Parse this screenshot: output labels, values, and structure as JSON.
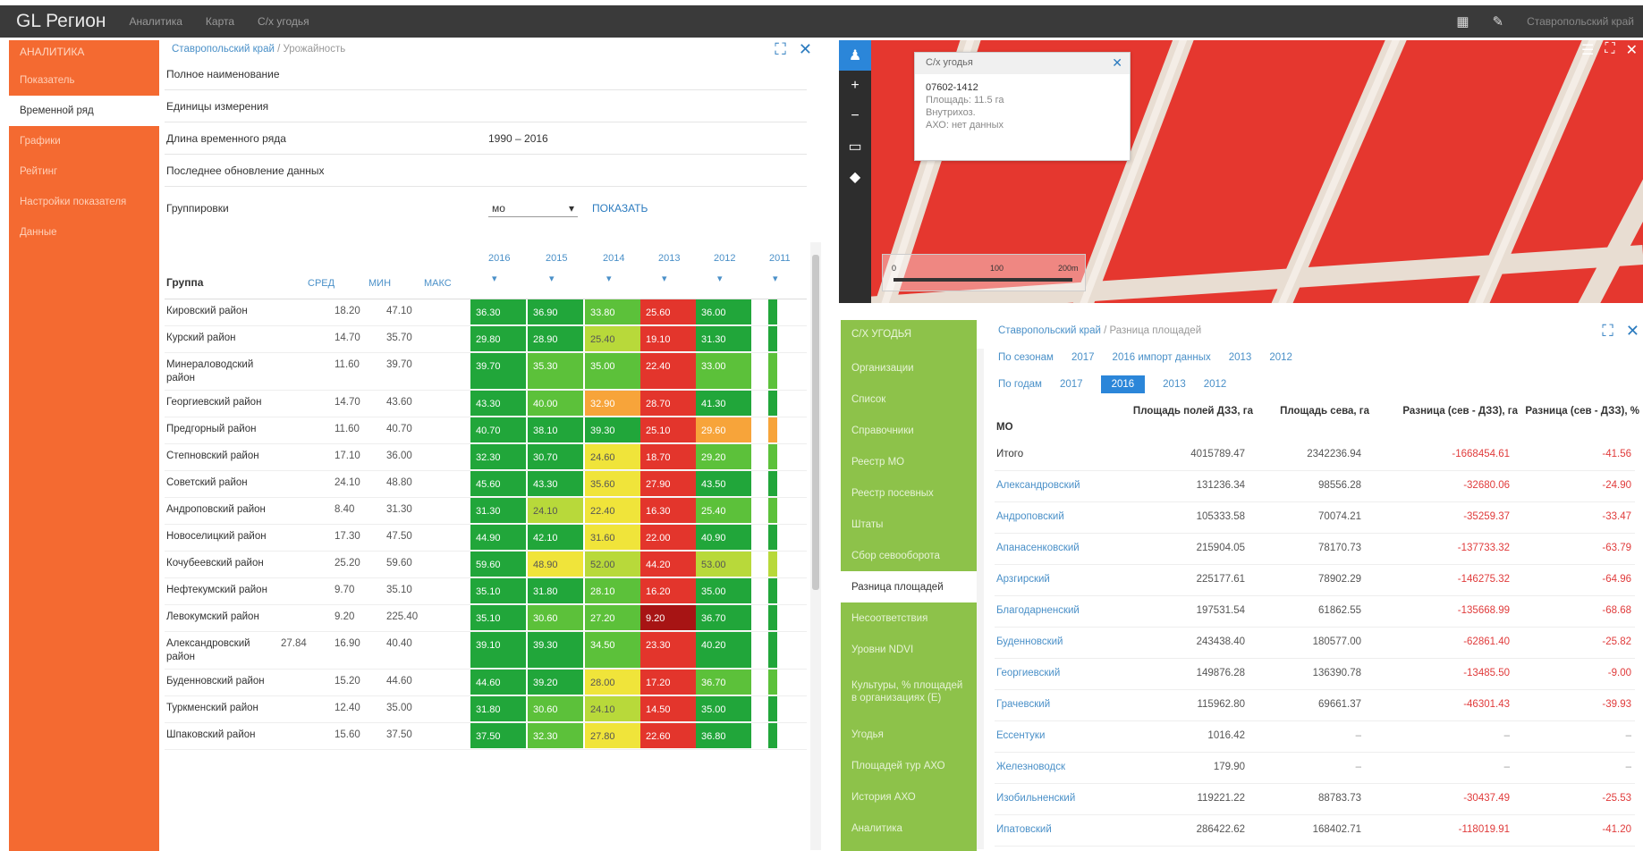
{
  "header": {
    "brand": "GL Регион",
    "nav": [
      "Аналитика",
      "Карта",
      "С/х угодья"
    ],
    "region": "Ставропольский край"
  },
  "left_sidebar": {
    "title": "АНАЛИТИКА",
    "items": [
      "Показатель",
      "Временной ряд",
      "Графики",
      "Рейтинг",
      "Настройки показателя",
      "Данные"
    ]
  },
  "ts_panel": {
    "breadcrumb": [
      "Ставропольский край",
      "Урожайность"
    ],
    "info": [
      {
        "label": "Полное наименование",
        "value": ""
      },
      {
        "label": "Единицы измерения",
        "value": ""
      },
      {
        "label": "Длина временного ряда",
        "value": "1990 – 2016"
      },
      {
        "label": "Последнее обновление данных",
        "value": ""
      }
    ],
    "group_label": "Группировки",
    "group_value": "мо",
    "show_btn": "ПОКАЗАТЬ",
    "columns": {
      "group": "Группа",
      "avg": "СРЕД",
      "min": "МИН",
      "max": "МАКС",
      "years": [
        "2016",
        "2015",
        "2014",
        "2013",
        "2012",
        "2011"
      ]
    },
    "rows": [
      {
        "name": "Кировский район",
        "avg": "",
        "min": "18.20",
        "max": "47.10",
        "vals": [
          "36.30",
          "36.90",
          "33.80",
          "25.60",
          "36.00"
        ]
      },
      {
        "name": "Курский район",
        "avg": "",
        "min": "14.70",
        "max": "35.70",
        "vals": [
          "29.80",
          "28.90",
          "25.40",
          "19.10",
          "31.30"
        ]
      },
      {
        "name": "Минераловодский район",
        "avg": "",
        "min": "11.60",
        "max": "39.70",
        "vals": [
          "39.70",
          "35.30",
          "35.00",
          "22.40",
          "33.00"
        ]
      },
      {
        "name": "Георгиевский район",
        "avg": "",
        "min": "14.70",
        "max": "43.60",
        "vals": [
          "43.30",
          "40.00",
          "32.90",
          "28.70",
          "41.30"
        ]
      },
      {
        "name": "Предгорный район",
        "avg": "",
        "min": "11.60",
        "max": "40.70",
        "vals": [
          "40.70",
          "38.10",
          "39.30",
          "25.10",
          "29.60"
        ]
      },
      {
        "name": "Степновский район",
        "avg": "",
        "min": "17.10",
        "max": "36.00",
        "vals": [
          "32.30",
          "30.70",
          "24.60",
          "18.70",
          "29.20"
        ]
      },
      {
        "name": "Советский район",
        "avg": "",
        "min": "24.10",
        "max": "48.80",
        "vals": [
          "45.60",
          "43.30",
          "35.60",
          "27.90",
          "43.50"
        ]
      },
      {
        "name": "Андроповский район",
        "avg": "",
        "min": "8.40",
        "max": "31.30",
        "vals": [
          "31.30",
          "24.10",
          "22.40",
          "16.30",
          "25.40"
        ]
      },
      {
        "name": "Новоселицкий район",
        "avg": "",
        "min": "17.30",
        "max": "47.50",
        "vals": [
          "44.90",
          "42.10",
          "31.60",
          "22.00",
          "40.90"
        ]
      },
      {
        "name": "Кочубеевский район",
        "avg": "",
        "min": "25.20",
        "max": "59.60",
        "vals": [
          "59.60",
          "48.90",
          "52.00",
          "44.20",
          "53.00"
        ]
      },
      {
        "name": "Нефтекумский район",
        "avg": "",
        "min": "9.70",
        "max": "35.10",
        "vals": [
          "35.10",
          "31.80",
          "28.10",
          "16.20",
          "35.00"
        ]
      },
      {
        "name": "Левокумский район",
        "avg": "",
        "min": "9.20",
        "max": "225.40",
        "vals": [
          "35.10",
          "30.60",
          "27.20",
          "9.20",
          "36.70"
        ]
      },
      {
        "name": "Александровский район",
        "avg": "27.84",
        "min": "16.90",
        "max": "40.40",
        "vals": [
          "39.10",
          "39.30",
          "34.50",
          "23.30",
          "40.20"
        ]
      },
      {
        "name": "Буденновский район",
        "avg": "",
        "min": "15.20",
        "max": "44.60",
        "vals": [
          "44.60",
          "39.20",
          "28.00",
          "17.20",
          "36.70"
        ]
      },
      {
        "name": "Туркменский район",
        "avg": "",
        "min": "12.40",
        "max": "35.00",
        "vals": [
          "31.80",
          "30.60",
          "24.10",
          "14.50",
          "35.00"
        ]
      },
      {
        "name": "Шпаковский район",
        "avg": "",
        "min": "15.60",
        "max": "37.50",
        "vals": [
          "37.50",
          "32.30",
          "27.80",
          "22.60",
          "36.80"
        ]
      }
    ]
  },
  "map": {
    "popup_title": "С/х угодья",
    "popup_id": "07602-1412",
    "popup_lines": [
      "Площадь: 11.5 га",
      "Внутрихоз.",
      "АХО: нет данных"
    ],
    "scale": [
      "0",
      "100",
      "200m"
    ]
  },
  "ag_sidebar": {
    "title": "С/Х УГОДЬЯ",
    "items": [
      "Организации",
      "Список",
      "Справочники",
      "Реестр МО",
      "Реестр посевных",
      "Штаты",
      "Сбор севооборота",
      "Разница площадей",
      "Несоответствия",
      "Уровни NDVI",
      "Культуры, % площадей в организациях (Е)",
      "Угодья",
      "Площадей тур АХО",
      "История АХО",
      "Аналитика"
    ]
  },
  "diff_panel": {
    "breadcrumb": [
      "Ставропольский край",
      "Разница площадей"
    ],
    "tabs1": [
      "По сезонам",
      "2017",
      "2016 импорт данных",
      "2013",
      "2012"
    ],
    "tabs2": [
      "По годам",
      "2017",
      "2016",
      "2013",
      "2012"
    ],
    "active_tab2": 2,
    "headers": [
      "МО",
      "Площадь полей ДЗЗ, га",
      "Площадь сева, га",
      "Разница (сев - ДЗЗ), га",
      "Разница (сев - ДЗЗ), %"
    ],
    "rows": [
      {
        "mo": "Итого",
        "c1": "4015789.47",
        "c2": "2342236.94",
        "c3": "-1668454.61",
        "c4": "-41.56"
      },
      {
        "mo": "Александровский",
        "c1": "131236.34",
        "c2": "98556.28",
        "c3": "-32680.06",
        "c4": "-24.90"
      },
      {
        "mo": "Андроповский",
        "c1": "105333.58",
        "c2": "70074.21",
        "c3": "-35259.37",
        "c4": "-33.47"
      },
      {
        "mo": "Апанасенковский",
        "c1": "215904.05",
        "c2": "78170.73",
        "c3": "-137733.32",
        "c4": "-63.79"
      },
      {
        "mo": "Арзгирский",
        "c1": "225177.61",
        "c2": "78902.29",
        "c3": "-146275.32",
        "c4": "-64.96"
      },
      {
        "mo": "Благодарненский",
        "c1": "197531.54",
        "c2": "61862.55",
        "c3": "-135668.99",
        "c4": "-68.68"
      },
      {
        "mo": "Буденновский",
        "c1": "243438.40",
        "c2": "180577.00",
        "c3": "-62861.40",
        "c4": "-25.82"
      },
      {
        "mo": "Георгиевский",
        "c1": "149876.28",
        "c2": "136390.78",
        "c3": "-13485.50",
        "c4": "-9.00"
      },
      {
        "mo": "Грачевский",
        "c1": "115962.80",
        "c2": "69661.37",
        "c3": "-46301.43",
        "c4": "-39.93"
      },
      {
        "mo": "Ессентуки",
        "c1": "1016.42",
        "c2": "–",
        "c3": "–",
        "c4": "–"
      },
      {
        "mo": "Железноводск",
        "c1": "179.90",
        "c2": "–",
        "c3": "–",
        "c4": "–"
      },
      {
        "mo": "Изобильненский",
        "c1": "119221.22",
        "c2": "88783.73",
        "c3": "-30437.49",
        "c4": "-25.53"
      },
      {
        "mo": "Ипатовский",
        "c1": "286422.62",
        "c2": "168402.71",
        "c3": "-118019.91",
        "c4": "-41.20"
      }
    ]
  }
}
